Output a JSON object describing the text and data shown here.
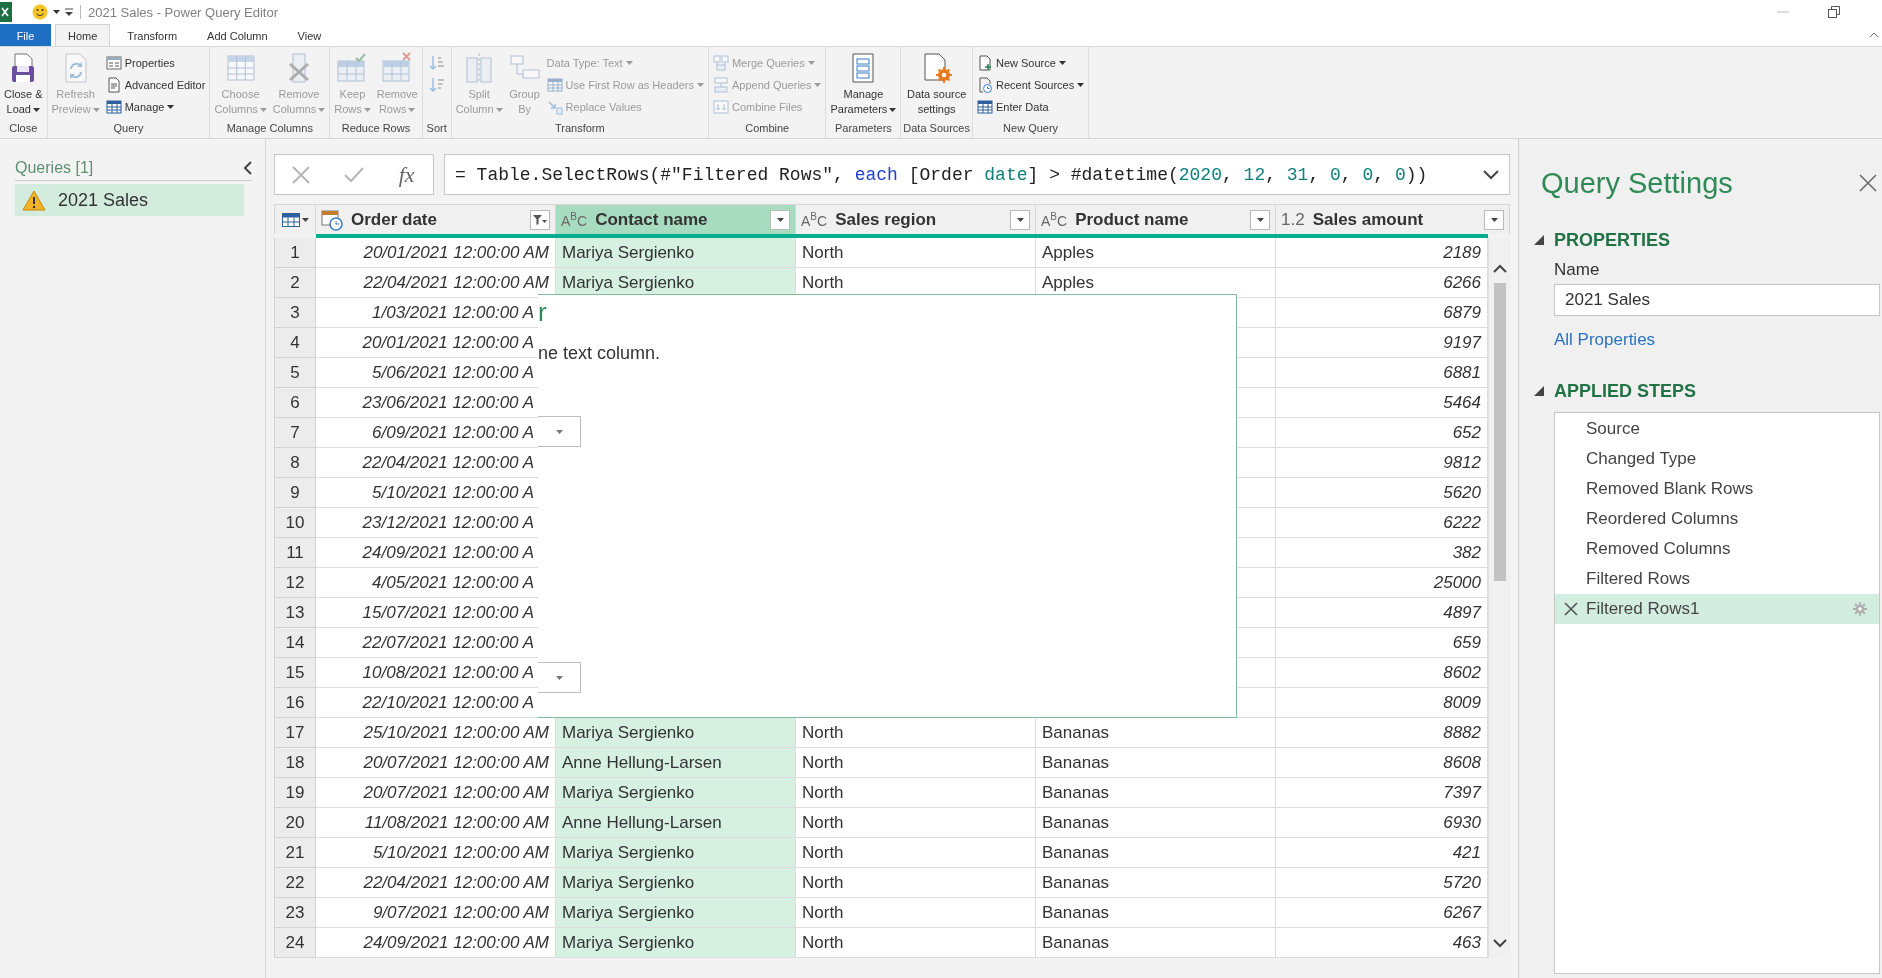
{
  "title_bar": {
    "title": "2021 Sales - Power Query Editor"
  },
  "ribbon_tabs": [
    {
      "label": "File",
      "kind": "file",
      "selected": false
    },
    {
      "label": "Home",
      "kind": "tab",
      "selected": true
    },
    {
      "label": "Transform",
      "kind": "tab",
      "selected": false
    },
    {
      "label": "Add Column",
      "kind": "tab",
      "selected": false
    },
    {
      "label": "View",
      "kind": "tab",
      "selected": false
    }
  ],
  "ribbon_groups": [
    {
      "label": "Close",
      "items": [
        {
          "kind": "large",
          "lines": [
            "Close &",
            "Load"
          ],
          "dropdown": true,
          "disabled": false
        }
      ]
    },
    {
      "label": "Query",
      "items": [
        {
          "kind": "large",
          "lines": [
            "Refresh",
            "Preview"
          ],
          "dropdown": true,
          "disabled": true
        },
        {
          "kind": "small",
          "label": "Properties",
          "dropdown": false,
          "disabled": false
        },
        {
          "kind": "small",
          "label": "Advanced Editor",
          "dropdown": false,
          "disabled": false
        },
        {
          "kind": "small",
          "label": "Manage",
          "dropdown": true,
          "disabled": false
        }
      ]
    },
    {
      "label": "Manage Columns",
      "items": [
        {
          "kind": "large",
          "lines": [
            "Choose",
            "Columns"
          ],
          "dropdown": true,
          "disabled": true
        },
        {
          "kind": "large",
          "lines": [
            "Remove",
            "Columns"
          ],
          "dropdown": true,
          "disabled": true
        }
      ]
    },
    {
      "label": "Reduce Rows",
      "items": [
        {
          "kind": "large",
          "lines": [
            "Keep",
            "Rows"
          ],
          "dropdown": true,
          "disabled": true
        },
        {
          "kind": "large",
          "lines": [
            "Remove",
            "Rows"
          ],
          "dropdown": true,
          "disabled": true
        }
      ]
    },
    {
      "label": "Sort",
      "items": [
        {
          "kind": "icon",
          "disabled": true
        },
        {
          "kind": "icon",
          "disabled": true
        }
      ]
    },
    {
      "label": "Transform",
      "items": [
        {
          "kind": "large",
          "lines": [
            "Split",
            "Column"
          ],
          "dropdown": true,
          "disabled": true
        },
        {
          "kind": "large",
          "lines": [
            "Group",
            "By"
          ],
          "dropdown": false,
          "disabled": true
        },
        {
          "kind": "small",
          "label": "Data Type: Text",
          "dropdown": true,
          "disabled": true
        },
        {
          "kind": "small",
          "label": "Use First Row as Headers",
          "dropdown": true,
          "disabled": true
        },
        {
          "kind": "small",
          "label": "Replace Values",
          "dropdown": false,
          "disabled": true
        }
      ]
    },
    {
      "label": "Combine",
      "items": [
        {
          "kind": "small",
          "label": "Merge Queries",
          "dropdown": true,
          "disabled": true
        },
        {
          "kind": "small",
          "label": "Append Queries",
          "dropdown": true,
          "disabled": true
        },
        {
          "kind": "small",
          "label": "Combine Files",
          "dropdown": false,
          "disabled": true
        }
      ]
    },
    {
      "label": "Parameters",
      "items": [
        {
          "kind": "large",
          "lines": [
            "Manage",
            "Parameters"
          ],
          "dropdown": true,
          "disabled": false
        }
      ]
    },
    {
      "label": "Data Sources",
      "items": [
        {
          "kind": "large",
          "lines": [
            "Data source",
            "settings"
          ],
          "dropdown": false,
          "disabled": false
        }
      ]
    },
    {
      "label": "New Query",
      "items": [
        {
          "kind": "small",
          "label": "New Source",
          "dropdown": true,
          "disabled": false
        },
        {
          "kind": "small",
          "label": "Recent Sources",
          "dropdown": true,
          "disabled": false
        },
        {
          "kind": "small",
          "label": "Enter Data",
          "dropdown": false,
          "disabled": false
        }
      ]
    }
  ],
  "queries_pane": {
    "title": "Queries [1]",
    "items": [
      {
        "name": "2021 Sales",
        "selected": true,
        "warning": true
      }
    ]
  },
  "formula_bar": {
    "function_label": "fx",
    "tokens": [
      {
        "text": "= Table.SelectRows(#\"Filtered Rows\", ",
        "kind": "plain"
      },
      {
        "text": "each",
        "kind": "keyword"
      },
      {
        "text": " [Order ",
        "kind": "plain"
      },
      {
        "text": "date",
        "kind": "literal"
      },
      {
        "text": "] > #datetime(",
        "kind": "plain"
      },
      {
        "text": "2020",
        "kind": "literal"
      },
      {
        "text": ", ",
        "kind": "plain"
      },
      {
        "text": "12",
        "kind": "literal"
      },
      {
        "text": ", ",
        "kind": "plain"
      },
      {
        "text": "31",
        "kind": "literal"
      },
      {
        "text": ", ",
        "kind": "plain"
      },
      {
        "text": "0",
        "kind": "literal"
      },
      {
        "text": ", ",
        "kind": "plain"
      },
      {
        "text": "0",
        "kind": "literal"
      },
      {
        "text": ", ",
        "kind": "plain"
      },
      {
        "text": "0",
        "kind": "literal"
      },
      {
        "text": "))",
        "kind": "plain"
      }
    ]
  },
  "table": {
    "columns": [
      {
        "name": "Order date",
        "kind": "datetime",
        "filtered": true,
        "selected": false
      },
      {
        "name": "Contact name",
        "kind": "text",
        "type_label": "A$^{B}$C",
        "filtered": false,
        "selected": true
      },
      {
        "name": "Sales region",
        "kind": "text",
        "type_label": "A$^{B}$C",
        "filtered": false,
        "selected": false
      },
      {
        "name": "Product name",
        "kind": "text",
        "type_label": "A$^{B}$C",
        "filtered": false,
        "selected": false
      },
      {
        "name": "Sales amount",
        "kind": "number",
        "type_label": "1.2",
        "filtered": false,
        "selected": false
      }
    ],
    "rows": [
      {
        "index": "1",
        "cells": [
          "20/01/2021 12:00:00 AM",
          "Mariya Sergienko",
          "North",
          "Apples",
          "2189"
        ]
      },
      {
        "index": "2",
        "cells": [
          "22/04/2021 12:00:00 AM",
          "Mariya Sergienko",
          "North",
          "Apples",
          "6266"
        ]
      },
      {
        "index": "3",
        "cells": [
          "1/03/2021 12:00:00 A",
          null,
          null,
          null,
          "6879"
        ]
      },
      {
        "index": "4",
        "cells": [
          "20/01/2021 12:00:00 A",
          null,
          null,
          null,
          "9197"
        ]
      },
      {
        "index": "5",
        "cells": [
          "5/06/2021 12:00:00 A",
          null,
          null,
          null,
          "6881"
        ]
      },
      {
        "index": "6",
        "cells": [
          "23/06/2021 12:00:00 A",
          null,
          null,
          null,
          "5464"
        ]
      },
      {
        "index": "7",
        "cells": [
          "6/09/2021 12:00:00 A",
          null,
          null,
          null,
          "652"
        ]
      },
      {
        "index": "8",
        "cells": [
          "22/04/2021 12:00:00 A",
          null,
          null,
          null,
          "9812"
        ]
      },
      {
        "index": "9",
        "cells": [
          "5/10/2021 12:00:00 A",
          null,
          null,
          null,
          "5620"
        ]
      },
      {
        "index": "10",
        "cells": [
          "23/12/2021 12:00:00 A",
          null,
          null,
          null,
          "6222"
        ]
      },
      {
        "index": "11",
        "cells": [
          "24/09/2021 12:00:00 A",
          null,
          null,
          null,
          "382"
        ]
      },
      {
        "index": "12",
        "cells": [
          "4/05/2021 12:00:00 A",
          null,
          null,
          null,
          "25000"
        ]
      },
      {
        "index": "13",
        "cells": [
          "15/07/2021 12:00:00 A",
          null,
          null,
          null,
          "4897"
        ]
      },
      {
        "index": "14",
        "cells": [
          "22/07/2021 12:00:00 A",
          null,
          null,
          null,
          "659"
        ]
      },
      {
        "index": "15",
        "cells": [
          "10/08/2021 12:00:00 A",
          null,
          null,
          null,
          "8602"
        ]
      },
      {
        "index": "16",
        "cells": [
          "22/10/2021 12:00:00 A",
          null,
          null,
          null,
          "8009"
        ]
      },
      {
        "index": "17",
        "cells": [
          "25/10/2021 12:00:00 AM",
          "Mariya Sergienko",
          "North",
          "Bananas",
          "8882"
        ]
      },
      {
        "index": "18",
        "cells": [
          "20/07/2021 12:00:00 AM",
          "Anne Hellung-Larsen",
          "North",
          "Bananas",
          "8608"
        ]
      },
      {
        "index": "19",
        "cells": [
          "20/07/2021 12:00:00 AM",
          "Mariya Sergienko",
          "North",
          "Bananas",
          "7397"
        ]
      },
      {
        "index": "20",
        "cells": [
          "11/08/2021 12:00:00 AM",
          "Anne Hellung-Larsen",
          "North",
          "Bananas",
          "6930"
        ]
      },
      {
        "index": "21",
        "cells": [
          "5/10/2021 12:00:00 AM",
          "Mariya Sergienko",
          "North",
          "Bananas",
          "421"
        ]
      },
      {
        "index": "22",
        "cells": [
          "22/04/2021 12:00:00 AM",
          "Mariya Sergienko",
          "North",
          "Bananas",
          "5720"
        ]
      },
      {
        "index": "23",
        "cells": [
          "9/07/2021 12:00:00 AM",
          "Mariya Sergienko",
          "North",
          "Bananas",
          "6267"
        ]
      },
      {
        "index": "24",
        "cells": [
          "24/09/2021 12:00:00 AM",
          "Mariya Sergienko",
          "North",
          "Bananas",
          "463"
        ]
      }
    ]
  },
  "dialog": {
    "title": "r",
    "description": "ne text column.",
    "fields": [
      {
        "kind": "dropdown"
      },
      {
        "kind": "dropdown"
      }
    ]
  },
  "query_settings": {
    "title": "Query Settings",
    "sections": [
      {
        "kind": "properties",
        "heading": "PROPERTIES",
        "expanded": true,
        "name_label": "Name",
        "name_value": "2021 Sales",
        "link": "All Properties"
      },
      {
        "kind": "steps",
        "heading": "APPLIED STEPS",
        "expanded": true,
        "steps": [
          {
            "label": "Source",
            "selected": false
          },
          {
            "label": "Changed Type",
            "selected": false
          },
          {
            "label": "Removed Blank Rows",
            "selected": false
          },
          {
            "label": "Reordered Columns",
            "selected": false
          },
          {
            "label": "Removed Columns",
            "selected": false
          },
          {
            "label": "Filtered Rows",
            "selected": false
          },
          {
            "label": "Filtered Rows1",
            "selected": true
          }
        ]
      }
    ]
  }
}
